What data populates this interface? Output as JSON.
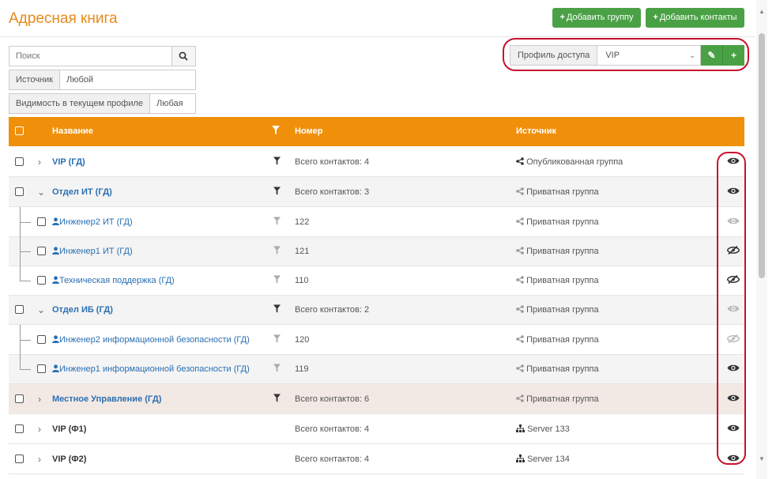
{
  "header": {
    "title": "Адресная книга",
    "add_group": "Добавить группу",
    "add_contacts": "Добавить контакты"
  },
  "search": {
    "placeholder": "Поиск"
  },
  "filters": {
    "source_label": "Источник",
    "source_value": "Любой",
    "visibility_label": "Видимость в текущем профиле",
    "visibility_value": "Любая"
  },
  "profile": {
    "label": "Профиль доступа",
    "value": "VIP"
  },
  "table": {
    "columns": {
      "name": "Название",
      "number": "Номер",
      "source": "Источник"
    },
    "rows": [
      {
        "name": "VIP (ГД)",
        "number": "Всего контактов: 4",
        "source": "Опубликованная группа"
      },
      {
        "name": "Отдел ИТ (ГД)",
        "number": "Всего контактов: 3",
        "source": "Приватная группа"
      },
      {
        "name": "Инженер2 ИТ (ГД)",
        "number": "122",
        "source": "Приватная группа"
      },
      {
        "name": "Инженер1 ИТ (ГД)",
        "number": "121",
        "source": "Приватная группа"
      },
      {
        "name": "Техническая поддержка (ГД)",
        "number": "110",
        "source": "Приватная группа"
      },
      {
        "name": "Отдел ИБ (ГД)",
        "number": "Всего контактов: 2",
        "source": "Приватная группа"
      },
      {
        "name": "Инженер2 информационной безопасности (ГД)",
        "number": "120",
        "source": "Приватная группа"
      },
      {
        "name": "Инженер1 информационной безопасности (ГД)",
        "number": "119",
        "source": "Приватная группа"
      },
      {
        "name": "Местное Управление (ГД)",
        "number": "Всего контактов: 6",
        "source": "Приватная группа"
      },
      {
        "name": "VIP (Ф1)",
        "number": "Всего контактов: 4",
        "source": "Server 133"
      },
      {
        "name": "VIP (Ф2)",
        "number": "Всего контактов: 4",
        "source": "Server 134"
      }
    ]
  },
  "colors": {
    "accent": "#f0900a",
    "button": "#4aa145",
    "link": "#2a6fb3",
    "highlight": "#c8102e"
  }
}
